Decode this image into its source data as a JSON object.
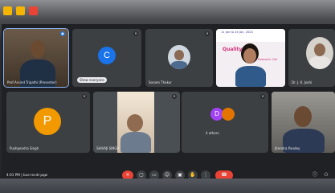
{
  "window_controls": [
    {
      "icon": "window-control-icon",
      "color": "#f4b400"
    },
    {
      "icon": "window-control-icon",
      "color": "#f4b400"
    },
    {
      "icon": "window-control-icon",
      "color": "#ea4335"
    }
  ],
  "participants": [
    {
      "name": "Prof Arvind Tripathi (Presenter)",
      "type": "video",
      "active": true
    },
    {
      "name": "",
      "type": "avatar",
      "initial": "C",
      "avatar_color": "#1a73e8"
    },
    {
      "name": "Sonam Thakur",
      "type": "video"
    },
    {
      "name": "",
      "type": "screen-share",
      "slide_lines": [
        "11 Jan to 24 Jan, 2024",
        "Quality",
        "Research Cell"
      ]
    },
    {
      "name": "Dr. J. K. Joshi",
      "type": "video"
    },
    {
      "name": "Pushpendra Singh",
      "type": "avatar",
      "initial": "P",
      "avatar_color": "#f29900"
    },
    {
      "name": "SHIVAJI SINGH",
      "type": "video"
    },
    {
      "name": "",
      "type": "video"
    },
    {
      "name": "4 others",
      "type": "group",
      "initials": [
        "D",
        ""
      ],
      "avatar_colors": [
        "#a142f4",
        "#e37400"
      ]
    },
    {
      "name": "Jitendra Pandey",
      "type": "video"
    }
  ],
  "presenting_chip": "Show everyone",
  "control_bar": {
    "time": "4:01 PM",
    "meeting_code": "bue-mcdr-pqw",
    "buttons": [
      {
        "icon": "mic-off-icon",
        "glyph": "✕",
        "color": "#ea4335"
      },
      {
        "icon": "camera-icon",
        "glyph": "▢",
        "color": "#3c4043"
      },
      {
        "icon": "captions-icon",
        "glyph": "▭",
        "color": "#3c4043"
      },
      {
        "icon": "emoji-icon",
        "glyph": "☺",
        "color": "#3c4043"
      },
      {
        "icon": "present-icon",
        "glyph": "▣",
        "color": "#3c4043"
      },
      {
        "icon": "raise-hand-icon",
        "glyph": "✋",
        "color": "#3c4043"
      },
      {
        "icon": "more-options-icon",
        "glyph": "⋮",
        "color": "#3c4043"
      },
      {
        "icon": "leave-call-icon",
        "glyph": "☎",
        "color": "#ea4335"
      }
    ],
    "right_icons": [
      {
        "icon": "info-icon",
        "glyph": "ⓘ"
      },
      {
        "icon": "people-icon",
        "glyph": "⚇"
      }
    ]
  }
}
